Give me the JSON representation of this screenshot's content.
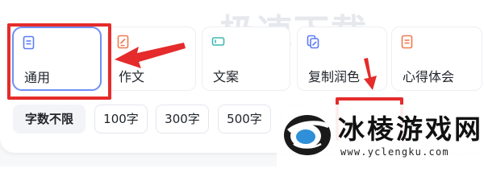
{
  "watermark_top": "极速下载",
  "cards": [
    {
      "label": "通用",
      "icon": "document-icon",
      "color": "#5b7cf6",
      "selected": true
    },
    {
      "label": "作文",
      "icon": "edit-document-icon",
      "color": "#f07a4f",
      "selected": false
    },
    {
      "label": "文案",
      "icon": "tag-icon",
      "color": "#3fb9b0",
      "selected": false
    },
    {
      "label": "复制润色",
      "icon": "copy-edit-icon",
      "color": "#5b7cf6",
      "selected": false
    },
    {
      "label": "心得体会",
      "icon": "notes-icon",
      "color": "#f07a4f",
      "selected": false
    }
  ],
  "chips": [
    {
      "label": "字数不限",
      "active": true
    },
    {
      "label": "100字",
      "active": false
    },
    {
      "label": "300字",
      "active": false
    },
    {
      "label": "500字",
      "active": false
    }
  ],
  "logo": {
    "name": "冰棱游戏网",
    "url": "www.yclengku.com"
  },
  "colors": {
    "annotation_red": "#e52b2b",
    "selected_border": "#6f8ff5"
  }
}
